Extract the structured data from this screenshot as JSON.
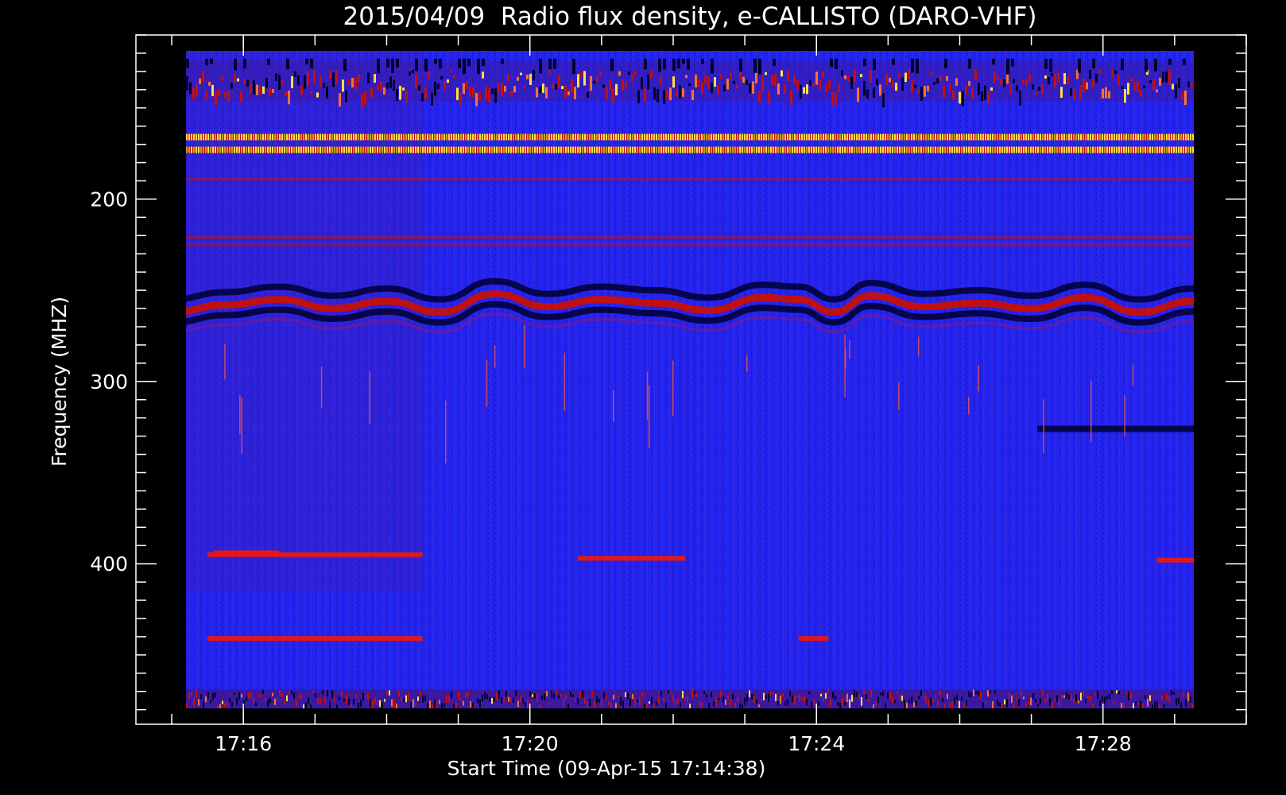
{
  "chart_data": {
    "type": "heatmap",
    "title": "2015/04/09  Radio flux density, e-CALLISTO (DARO-VHF)",
    "xlabel": "Start Time (09-Apr-15 17:14:38)",
    "ylabel": "Frequency (MHZ)",
    "x_axis": {
      "unit": "time",
      "range": [
        "17:14:30",
        "17:30:00"
      ],
      "data_extent": [
        "17:15:00",
        "17:30:00"
      ],
      "major_ticks": [
        {
          "value": "17:16",
          "label": "17:16"
        },
        {
          "value": "17:20",
          "label": "17:20"
        },
        {
          "value": "17:24",
          "label": "17:24"
        },
        {
          "value": "17:28",
          "label": "17:28"
        }
      ],
      "minor_tick_interval_min": 1
    },
    "y_axis": {
      "unit": "MHz",
      "reversed": true,
      "range": [
        110,
        488
      ],
      "data_extent": [
        119,
        480
      ],
      "major_ticks": [
        {
          "value": 200,
          "label": "200"
        },
        {
          "value": 300,
          "label": "300"
        },
        {
          "value": 400,
          "label": "400"
        }
      ],
      "minor_tick_interval": 10
    },
    "colormap": {
      "background": "#2222f0",
      "low": "#000030",
      "mid": "#c01010",
      "high": "#ffe040"
    },
    "features": {
      "rfi_dense_band": [
        129,
        142
      ],
      "bright_lines_mhz": [
        166,
        173
      ],
      "faint_lines_mhz": [
        189,
        221,
        225
      ],
      "wave_band_center_mhz": 258,
      "wave_band_profile": [
        {
          "t": "17:15:00",
          "f": 262
        },
        {
          "t": "17:15:45",
          "f": 258
        },
        {
          "t": "17:16:30",
          "f": 255
        },
        {
          "t": "17:17:15",
          "f": 260
        },
        {
          "t": "17:18:00",
          "f": 256
        },
        {
          "t": "17:18:45",
          "f": 262
        },
        {
          "t": "17:19:30",
          "f": 252
        },
        {
          "t": "17:20:15",
          "f": 259
        },
        {
          "t": "17:21:00",
          "f": 255
        },
        {
          "t": "17:21:45",
          "f": 257
        },
        {
          "t": "17:22:30",
          "f": 261
        },
        {
          "t": "17:23:15",
          "f": 254
        },
        {
          "t": "17:23:45",
          "f": 255
        },
        {
          "t": "17:24:15",
          "f": 262
        },
        {
          "t": "17:24:45",
          "f": 253
        },
        {
          "t": "17:25:30",
          "f": 259
        },
        {
          "t": "17:26:15",
          "f": 257
        },
        {
          "t": "17:27:00",
          "f": 260
        },
        {
          "t": "17:27:45",
          "f": 254
        },
        {
          "t": "17:28:30",
          "f": 262
        },
        {
          "t": "17:29:15",
          "f": 256
        },
        {
          "t": "17:30:00",
          "f": 259
        }
      ],
      "red_segments": [
        {
          "t0": "17:15:35",
          "t1": "17:16:30",
          "f": 394
        },
        {
          "t0": "17:15:30",
          "t1": "17:18:30",
          "f": 395
        },
        {
          "t0": "17:20:40",
          "t1": "17:22:10",
          "f": 397
        },
        {
          "t0": "17:28:45",
          "t1": "17:30:00",
          "f": 398
        },
        {
          "t0": "17:23:45",
          "t1": "17:24:10",
          "f": 441
        },
        {
          "t0": "17:15:30",
          "t1": "17:18:30",
          "f": 441
        }
      ],
      "dark_segments": [
        {
          "t0": "17:27:05",
          "t1": "17:30:00",
          "f": 326
        }
      ],
      "rfi_dense_band_bottom": [
        469,
        479
      ]
    }
  }
}
